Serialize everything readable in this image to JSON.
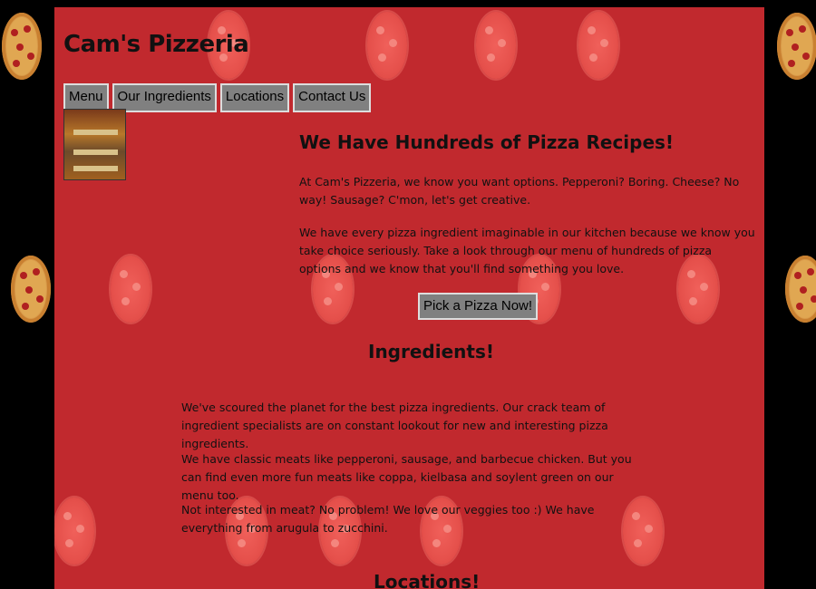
{
  "header": {
    "title": "Cam's Pizzeria"
  },
  "nav": {
    "items": [
      {
        "label": "Menu"
      },
      {
        "label": "Our Ingredients"
      },
      {
        "label": "Locations"
      },
      {
        "label": "Contact Us"
      }
    ]
  },
  "intro": {
    "heading": "We Have Hundreds of Pizza Recipes!",
    "paragraphs": [
      "At Cam's Pizzeria, we know you want options. Pepperoni? Boring. Cheese? No way! Sausage? C'mon, let's get creative.",
      "We have every pizza ingredient imaginable in our kitchen because we know you take choice seriously. Take a look through our menu of hundreds of pizza options and we know that you'll find something you love."
    ],
    "cta_label": "Pick a Pizza Now!"
  },
  "ingredients": {
    "heading": "Ingredients!",
    "paragraphs": [
      "We've scoured the planet for the best pizza ingredients. Our crack team of ingredient specialists are on constant lookout for new and interesting pizza ingredients.",
      "We have classic meats like pepperoni, sausage, and barbecue chicken. But you can find even more fun meats like coppa, kielbasa and soylent green on our menu too.",
      "Not interested in meat? No problem! We love our veggies too :) We have everything from arugula to zucchini."
    ]
  },
  "locations": {
    "heading": "Locations!"
  },
  "colors": {
    "page_bg": "#c1292e",
    "outer_bg": "#000000",
    "button_bg": "#808080"
  }
}
